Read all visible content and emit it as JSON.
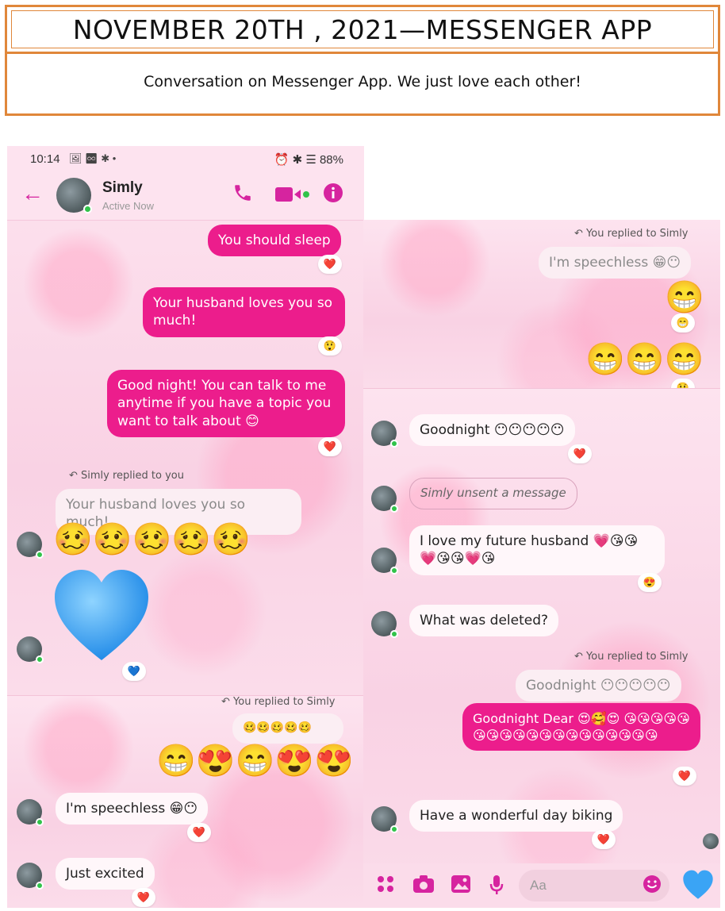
{
  "header": {
    "title": "NOVEMBER 20TH , 2021—MESSENGER APP",
    "subtitle": "Conversation on Messenger App. We just love each other!"
  },
  "status_bar": {
    "time": "10:14",
    "left_icons": "🖼 ♾ ✱ •",
    "right_icons": "⏰ ✱ ☰",
    "battery": "88%"
  },
  "contact": {
    "name": "Simly",
    "status": "Active Now"
  },
  "left": {
    "m1": "You should sleep",
    "m1_react": "❤️",
    "m2": "Your husband loves you so much!",
    "m2_react": "😲",
    "m3": "Good night! You can talk to me anytime if you have a topic you want to talk about 😊",
    "m3_react": "❤️",
    "reply_note": "Simly replied to you",
    "quoted": "Your husband loves you so much!",
    "emoji_row": "🥴🥴🥴🥴🥴",
    "big_heart_react": "💙",
    "reply_note2": "You replied to Simly",
    "quoted2": "🥴🥴🥴🥴🥴",
    "emoji_row2": "😁😍😁😍😍",
    "m4": "I'm speechless 😁😶",
    "m4_react": "❤️",
    "m5": "Just excited",
    "m5_react": "❤️"
  },
  "right": {
    "reply_note": "You replied to Simly",
    "quoted": "I'm speechless 😁😶",
    "grin": "😁",
    "grin_react": "😁",
    "grin_row": "😁😁😁",
    "grin_row_react": "😲",
    "m1": "Goodnight 😶😶😶😶😶",
    "m1_react": "❤️",
    "unsent": "Simly unsent a message",
    "m2": "I love my future husband 💗😘😘 💗😘😘💗😘",
    "m2_react": "😍",
    "m3": "What was deleted?",
    "reply_note2": "You replied to Simly",
    "quoted2": "Goodnight 😶😶😶😶😶",
    "m4": "Goodnight Dear 😍🥰😍 😘😘😘😘😘😘😘😘😘😘😘😘😘😘😘😘😘😘😘",
    "m4_react": "❤️",
    "m5": "Have a wonderful day biking",
    "m5_react": "❤️",
    "composer_placeholder": "Aa"
  },
  "colors": {
    "brand": "#d6249f",
    "outgoing": "#ec1d8c",
    "frame": "#e0873a"
  }
}
